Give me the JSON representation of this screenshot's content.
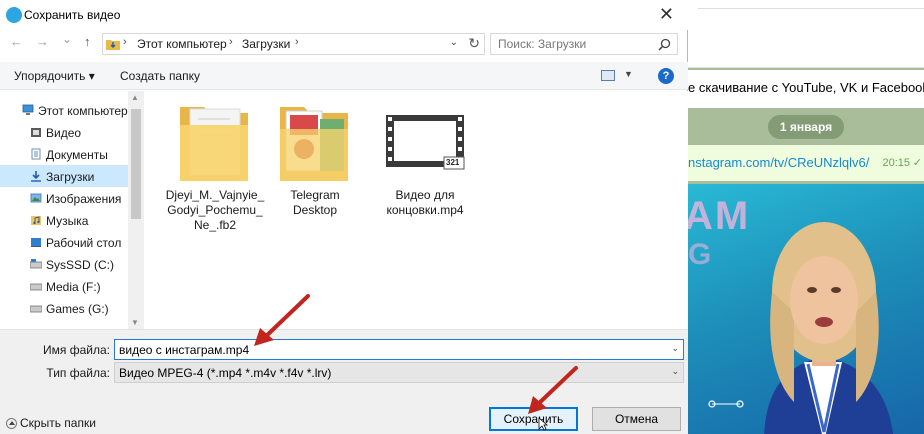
{
  "dialog": {
    "title": "Сохранить видео",
    "close_glyph": "✕",
    "nav": {
      "back": "←",
      "forward": "→",
      "recent": "⌄",
      "up": "↑",
      "breadcrumb": [
        "Этот компьютер",
        "Загрузки"
      ],
      "search_placeholder": "Поиск: Загрузки"
    },
    "toolbar": {
      "organize": "Упорядочить ▾",
      "new_folder": "Создать папку",
      "help": "?"
    },
    "tree": [
      {
        "label": "Этот компьютер",
        "icon": "computer-icon",
        "root": true
      },
      {
        "label": "Видео",
        "icon": "video-folder-icon"
      },
      {
        "label": "Документы",
        "icon": "documents-folder-icon"
      },
      {
        "label": "Загрузки",
        "icon": "downloads-folder-icon",
        "selected": true
      },
      {
        "label": "Изображения",
        "icon": "pictures-folder-icon"
      },
      {
        "label": "Музыка",
        "icon": "music-folder-icon"
      },
      {
        "label": "Рабочий стол",
        "icon": "desktop-folder-icon"
      },
      {
        "label": "SysSSD (C:)",
        "icon": "drive-icon"
      },
      {
        "label": "Media (F:)",
        "icon": "drive-icon"
      },
      {
        "label": "Games (G:)",
        "icon": "drive-icon"
      }
    ],
    "files": [
      {
        "name": "Djeyi_M._Vajnyie_\nGodyi_Pochemu_\nNe_.fb2",
        "icon": "folder-icon"
      },
      {
        "name": "Telegram\nDesktop",
        "icon": "folder-icon"
      },
      {
        "name": "Видео для\nконцовки.mp4",
        "icon": "video-file-icon",
        "badge": "321"
      }
    ],
    "filename_label": "Имя файла:",
    "filename_value": "видео с инстаграм.mp4",
    "filetype_label": "Тип файла:",
    "filetype_value": "Видео MPEG-4 (*.mp4 *.m4v *.f4v *.lrv)",
    "hide_folders": "Скрыть папки",
    "save_button": "Сохранить",
    "cancel_button": "Отмена"
  },
  "telegram": {
    "message1": "е скачивание с YouTube, VK и Facebook.",
    "date_badge": "1 января",
    "message2_link": "nstagram.com/tv/CReUNzlqlv6/",
    "message2_time": "20:15",
    "message2_check": "✓",
    "video_overlay_text": "AM",
    "video_overlay_text2": "G"
  },
  "colors": {
    "accent": "#0078d7",
    "selection": "#cce8ff",
    "folder": "#f2c75c",
    "telegram_link": "#168acd",
    "annotation_arrow": "#c0261e"
  }
}
